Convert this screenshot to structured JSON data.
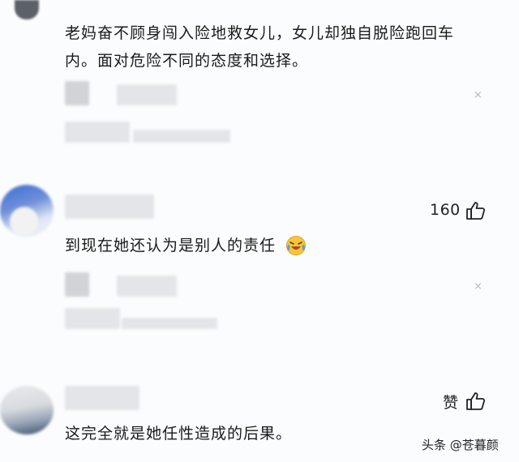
{
  "comments": [
    {
      "text_line1": "老妈奋不顾身闯入险地救女儿，女儿却独自脱险跑回车",
      "text_line2": "内。面对危险不同的态度和选择。"
    },
    {
      "text": "到现在她还认为是别人的责任",
      "emoji": "cry-laugh-emoji",
      "likes": "160"
    },
    {
      "text": "这完全就是她任性造成的后果。",
      "likes": "赞"
    }
  ],
  "close_glyph": "×",
  "watermark": "头条 @苍暮颜",
  "icons": {
    "like": "thumb-up-icon",
    "close": "close-icon"
  }
}
